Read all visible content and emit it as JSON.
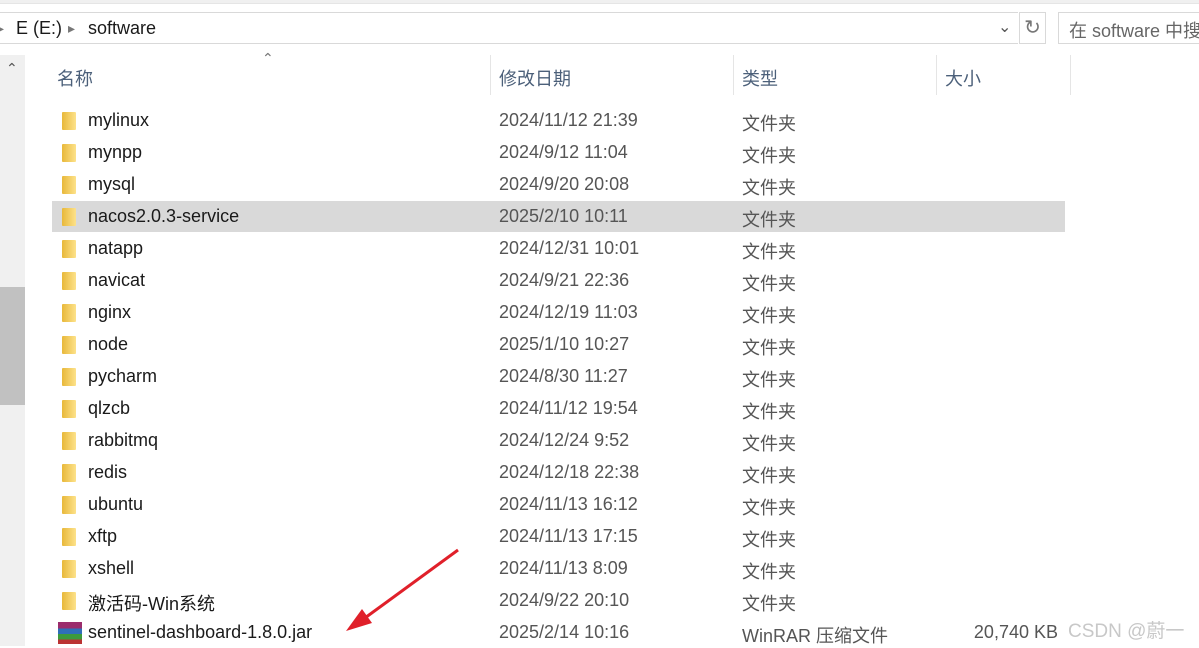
{
  "breadcrumb": [
    "E (E:)",
    "software"
  ],
  "search": {
    "placeholder": "在 software 中搜"
  },
  "columns": {
    "name": "名称",
    "date": "修改日期",
    "type": "类型",
    "size": "大小"
  },
  "selected_index": 3,
  "rows": [
    {
      "name": "mylinux",
      "date": "2024/11/12 21:39",
      "type": "文件夹",
      "size": "",
      "icon": "folder-icon"
    },
    {
      "name": "mynpp",
      "date": "2024/9/12 11:04",
      "type": "文件夹",
      "size": "",
      "icon": "folder-icon"
    },
    {
      "name": "mysql",
      "date": "2024/9/20 20:08",
      "type": "文件夹",
      "size": "",
      "icon": "folder-icon"
    },
    {
      "name": "nacos2.0.3-service",
      "date": "2025/2/10 10:11",
      "type": "文件夹",
      "size": "",
      "icon": "folder-icon"
    },
    {
      "name": "natapp",
      "date": "2024/12/31 10:01",
      "type": "文件夹",
      "size": "",
      "icon": "folder-icon"
    },
    {
      "name": "navicat",
      "date": "2024/9/21 22:36",
      "type": "文件夹",
      "size": "",
      "icon": "folder-icon"
    },
    {
      "name": "nginx",
      "date": "2024/12/19 11:03",
      "type": "文件夹",
      "size": "",
      "icon": "folder-icon"
    },
    {
      "name": "node",
      "date": "2025/1/10 10:27",
      "type": "文件夹",
      "size": "",
      "icon": "folder-icon"
    },
    {
      "name": "pycharm",
      "date": "2024/8/30 11:27",
      "type": "文件夹",
      "size": "",
      "icon": "folder-icon"
    },
    {
      "name": "qlzcb",
      "date": "2024/11/12 19:54",
      "type": "文件夹",
      "size": "",
      "icon": "folder-icon"
    },
    {
      "name": "rabbitmq",
      "date": "2024/12/24 9:52",
      "type": "文件夹",
      "size": "",
      "icon": "folder-icon"
    },
    {
      "name": "redis",
      "date": "2024/12/18 22:38",
      "type": "文件夹",
      "size": "",
      "icon": "folder-icon"
    },
    {
      "name": "ubuntu",
      "date": "2024/11/13 16:12",
      "type": "文件夹",
      "size": "",
      "icon": "folder-icon"
    },
    {
      "name": "xftp",
      "date": "2024/11/13 17:15",
      "type": "文件夹",
      "size": "",
      "icon": "folder-icon"
    },
    {
      "name": "xshell",
      "date": "2024/11/13 8:09",
      "type": "文件夹",
      "size": "",
      "icon": "folder-icon"
    },
    {
      "name": "激活码-Win系统",
      "date": "2024/9/22 20:10",
      "type": "文件夹",
      "size": "",
      "icon": "folder-icon"
    },
    {
      "name": "sentinel-dashboard-1.8.0.jar",
      "date": "2025/2/14 10:16",
      "type": "WinRAR 压缩文件",
      "size": "20,740 KB",
      "icon": "winrar-archive-icon"
    }
  ],
  "watermark": "CSDN @蔚一",
  "annotation_color": "#e0202a"
}
